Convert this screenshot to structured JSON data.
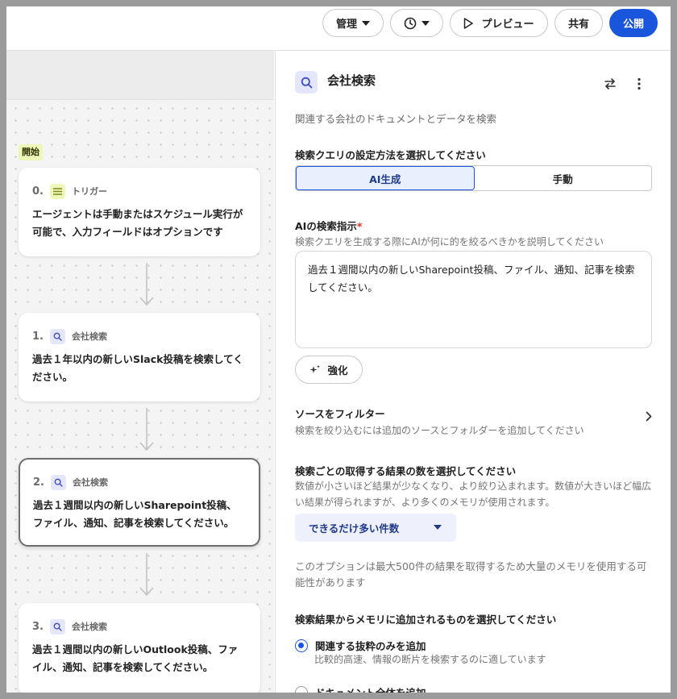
{
  "toolbar": {
    "manage_label": "管理",
    "preview_label": "プレビュー",
    "share_label": "共有",
    "publish_label": "公開"
  },
  "canvas": {
    "start_label": "開始",
    "nodes": [
      {
        "num": "0.",
        "type": "トリガー",
        "body": "エージェントは手動またはスケジュール実行が可能で、入力フィールドはオプションです"
      },
      {
        "num": "1.",
        "type": "会社検索",
        "body": "過去１年以内の新しいSlack投稿を検索してください。"
      },
      {
        "num": "2.",
        "type": "会社検索",
        "body": "過去１週間以内の新しいSharepoint投稿、ファイル、通知、記事を検索してください。"
      },
      {
        "num": "3.",
        "type": "会社検索",
        "body": "過去１週間以内の新しいOutlook投稿、ファイル、通知、記事を検索してください。"
      }
    ]
  },
  "panel": {
    "title": "会社検索",
    "description": "関連する会社のドキュメントとデータを検索",
    "query_mode_label": "検索クエリの設定方法を選択してください",
    "mode_options": [
      "AI生成",
      "手動"
    ],
    "ai_instruction_label": "AIの検索指示",
    "required_mark": "*",
    "ai_instruction_help": "検索クエリを生成する際にAIが何に的を絞るべきかを説明してください",
    "ai_instruction_value": "過去１週間以内の新しいSharepoint投稿、ファイル、通知、記事を検索してください。",
    "enhance_label": "強化",
    "filter_title": "ソースをフィルター",
    "filter_help": "検索を絞り込むには追加のソースとフォルダーを追加してください",
    "result_count_label": "検索ごとの取得する結果の数を選択してください",
    "result_count_help": "数値が小さいほど結果が少なくなり、より絞り込まれます。数値が大きいほど幅広い結果が得られますが、より多くのメモリが使用されます。",
    "result_count_value": "できるだけ多い件数",
    "result_count_note": "このオプションは最大500件の結果を取得するため大量のメモリを使用する可能性があります",
    "memory_label": "検索結果からメモリに追加されるものを選択してください",
    "memory_options": [
      {
        "label": "関連する抜粋のみを追加",
        "help": "比較的高速、情報の断片を検索するのに適しています",
        "selected": true
      },
      {
        "label": "ドキュメント全体を追加",
        "selected": false
      }
    ]
  },
  "colors": {
    "accent": "#1a56db",
    "trigger_badge": "#eef6b8",
    "search_badge": "#e4e6fb"
  }
}
